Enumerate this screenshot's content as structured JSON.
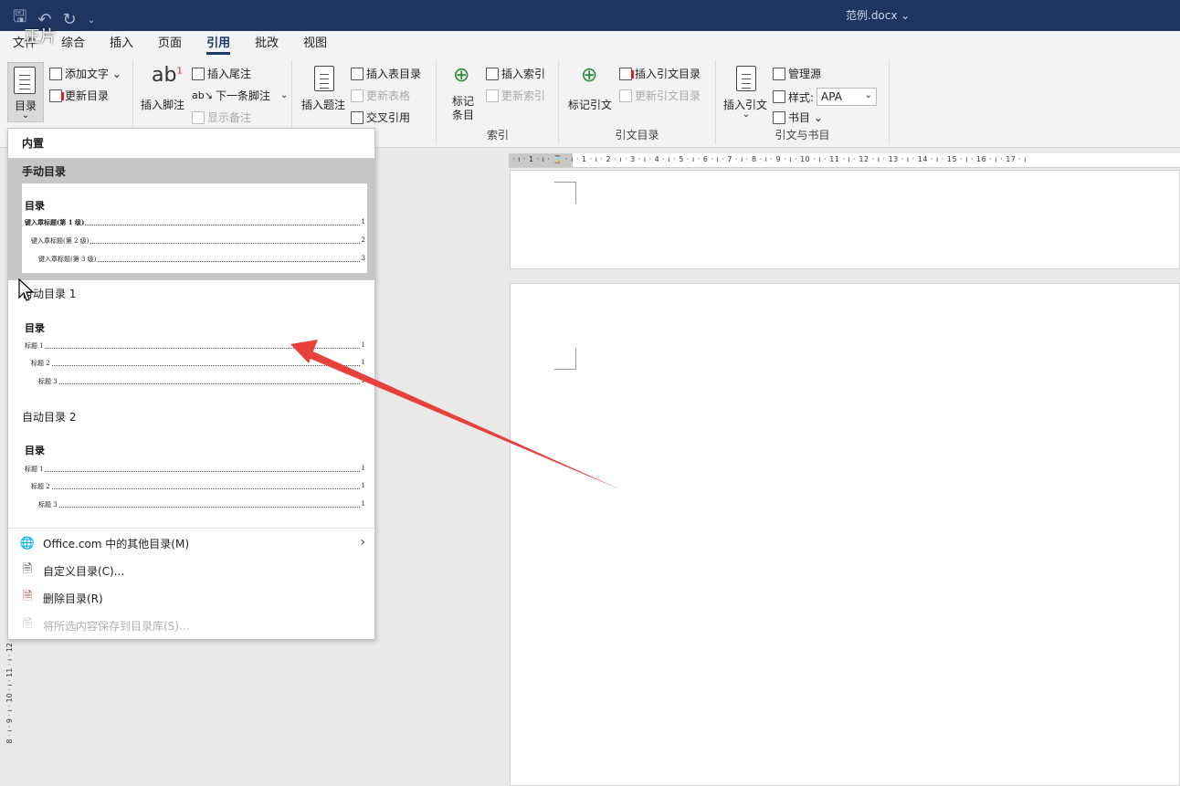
{
  "title_bar": {
    "doc_title": "范例.docx ⌄",
    "watermark": "正片"
  },
  "tabs": [
    {
      "label": "文件"
    },
    {
      "label": "综合"
    },
    {
      "label": "插入"
    },
    {
      "label": "页面"
    },
    {
      "label": "引用",
      "active": true
    },
    {
      "label": "批改"
    },
    {
      "label": "视图"
    }
  ],
  "ribbon": {
    "toc": {
      "button": "目录",
      "add_text": "添加文字 ⌄",
      "update_toc": "更新目录"
    },
    "footnotes": {
      "insert_footnote": "插入脚注",
      "insert_endnote": "插入尾注",
      "next_footnote": "下一条脚注",
      "show_notes": "显示备注"
    },
    "captions": {
      "insert_caption": "插入题注",
      "insert_table_of_figures": "插入表目录",
      "update_table": "更新表格",
      "cross_reference": "交叉引用"
    },
    "index": {
      "group_label": "索引",
      "mark_entry": "标记\n条目",
      "mark_entry_line1": "标记",
      "mark_entry_line2": "条目",
      "insert_index": "插入索引",
      "update_index": "更新索引"
    },
    "citation_toc": {
      "group_label": "引文目录",
      "mark_citation": "标记引文",
      "insert_toa": "插入引文目录",
      "update_toa": "更新引文目录"
    },
    "citations": {
      "group_label": "引文与书目",
      "insert_citation": "插入引文",
      "manage_sources": "管理源",
      "style_label": "样式:",
      "style_value": "APA",
      "bibliography": "书目 ⌄"
    }
  },
  "ruler": {
    "ticks": "· ı · 1 · ı · ⌛ · ı · 1 · ı · 2 · ı · 3 · ı · 4 · ı · 5 · ı · 6 · ı · 7 · ı · 8 · ı · 9 · ı · 10 · ı · 11 · ı · 12 · ı · 13 · ı · 14 · ı · 15 · ı · 16 · ı · 17 · ı"
  },
  "vruler": {
    "ticks": "8 · ı · 9 · ı · 10 · ı · 11 · ı · 12"
  },
  "dropdown": {
    "section_header": "内置",
    "manual": {
      "label": "手动目录",
      "preview_title": "目录",
      "lines": [
        {
          "text": "键入章标题(第 1 级)",
          "page": "1"
        },
        {
          "text": "键入章标题(第 2 级)",
          "page": "2"
        },
        {
          "text": "键入章标题(第 3 级)",
          "page": "3"
        }
      ]
    },
    "auto1": {
      "label": "自动目录 1",
      "preview_title": "目录",
      "lines": [
        {
          "text": "标题 1",
          "page": "1"
        },
        {
          "text": "标题 2",
          "page": "1"
        },
        {
          "text": "标题 3",
          "page": "1"
        }
      ]
    },
    "auto2": {
      "label": "自动目录 2",
      "preview_title": "目录",
      "lines": [
        {
          "text": "标题 1",
          "page": "1"
        },
        {
          "text": "标题 2",
          "page": "1"
        },
        {
          "text": "标题 3",
          "page": "1"
        }
      ]
    },
    "menu": {
      "more_office": "Office.com 中的其他目录(M)",
      "custom_toc": "自定义目录(C)...",
      "remove_toc": "删除目录(R)",
      "save_selection": "将所选内容保存到目录库(S)..."
    }
  },
  "colors": {
    "titlebar": "#1d355f",
    "accent": "#1b3a6b",
    "arrow": "#e8403a",
    "highlight": "#c6c6c6"
  }
}
